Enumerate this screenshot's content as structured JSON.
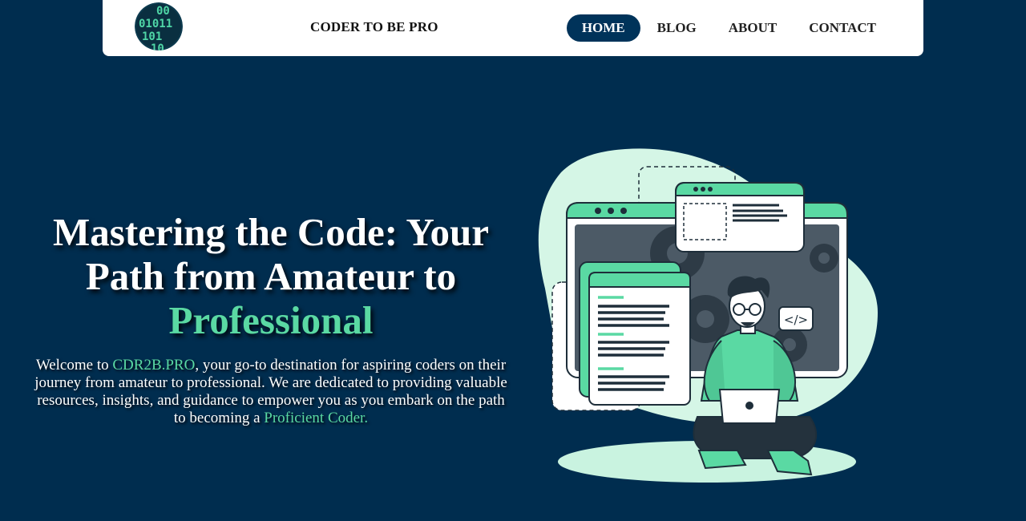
{
  "header": {
    "logo_alt": "binary code logo",
    "brand": "CODER TO BE PRO",
    "nav": [
      {
        "label": "HOME",
        "active": true
      },
      {
        "label": "BLOG",
        "active": false
      },
      {
        "label": "ABOUT",
        "active": false
      },
      {
        "label": "CONTACT",
        "active": false
      }
    ]
  },
  "hero": {
    "headline_part1": "Mastering the Code: Your Path from Amateur to",
    "headline_accent": "Professional",
    "intro_prefix": "Welcome to ",
    "intro_site": "CDR2B.PRO",
    "intro_body": ", your go-to destination for aspiring coders on their journey from amateur to professional. We are dedicated to providing valuable resources, insights, and guidance to empower you as you embark on the path to becoming a ",
    "intro_accent": "Proficient Coder.",
    "illustration_tag": "</>"
  },
  "colors": {
    "background": "#002d4f",
    "accent": "#5ad9a3",
    "nav_active": "#00335a",
    "navbar": "#ffffff"
  },
  "icons": [
    "binary-logo-icon",
    "developer-illustration"
  ]
}
